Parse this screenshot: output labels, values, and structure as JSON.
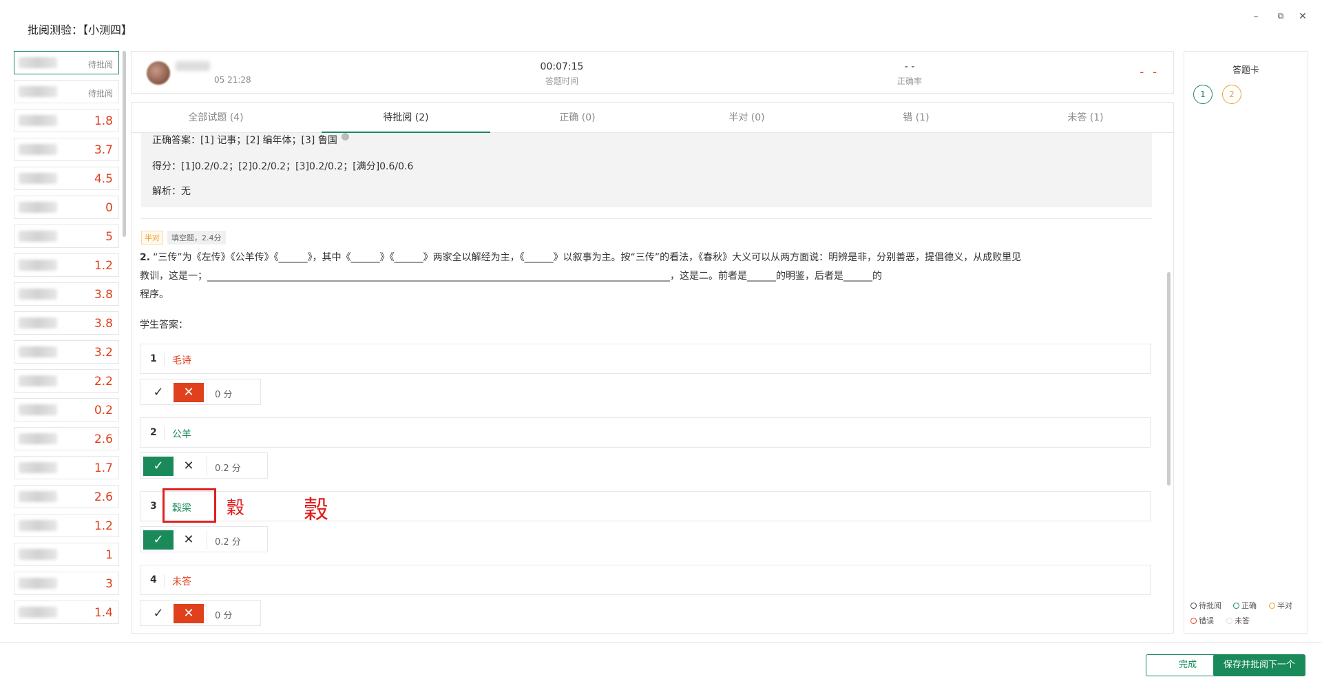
{
  "window": {
    "title": "批阅测验：【小测四】",
    "minimize": "–",
    "restore": "⧉",
    "close": "✕"
  },
  "students": [
    {
      "score": "待批阅",
      "pending": true,
      "active": true
    },
    {
      "score": "待批阅",
      "pending": true
    },
    {
      "score": "1.8"
    },
    {
      "score": "3.7"
    },
    {
      "score": "4.5"
    },
    {
      "score": "0"
    },
    {
      "score": "5"
    },
    {
      "score": "1.2"
    },
    {
      "score": "3.8"
    },
    {
      "score": "3.8"
    },
    {
      "score": "3.2"
    },
    {
      "score": "2.2"
    },
    {
      "score": "0.2"
    },
    {
      "score": "2.6"
    },
    {
      "score": "1.7"
    },
    {
      "score": "2.6"
    },
    {
      "score": "1.2"
    },
    {
      "score": "1"
    },
    {
      "score": "3"
    },
    {
      "score": "1.4"
    }
  ],
  "header": {
    "submit_time": "05 21:28",
    "duration_value": "00:07:15",
    "duration_label": "答题时间",
    "accuracy_value": "- -",
    "accuracy_label": "正确率",
    "score": "- -"
  },
  "tabs": [
    {
      "label": "全部试题 (4)"
    },
    {
      "label": "待批阅 (2)",
      "active": true
    },
    {
      "label": "正确 (0)"
    },
    {
      "label": "半对 (0)"
    },
    {
      "label": "错 (1)"
    },
    {
      "label": "未答 (1)"
    }
  ],
  "prev_question": {
    "correct_answer": "正确答案：[1] 记事；[2] 编年体；[3] 鲁国",
    "score_line": "得分：[1]0.2/0.2；[2]0.2/0.2；[3]0.2/0.2；[满分]0.6/0.6",
    "analysis": "解析：无"
  },
  "question": {
    "status_tag": "半对",
    "type_tag": "填空题，2.4分",
    "number": "2.",
    "line1": "“三传”为《左传》《公羊传》《______》，其中《______》《______》两家全以解经为主，《______》以叙事为主。按“三传”的看法，《春秋》大义可以从两方面说：明辨是非，分别善恶，提倡德义，从成败里见",
    "line2": "教训，这是一；________________________________________________________________________________________________，这是二。前者是______的明鉴，后者是______的",
    "line3": "程序。",
    "student_answer_label": "学生答案："
  },
  "answers": [
    {
      "num": "1",
      "text": "毛诗",
      "status": "wrong",
      "score": "0 分"
    },
    {
      "num": "2",
      "text": "公羊",
      "status": "right",
      "score": "0.2 分"
    },
    {
      "num": "3",
      "text": "穀梁",
      "status": "right",
      "score": "0.2 分"
    },
    {
      "num": "4",
      "text": "未答",
      "status": "wrong",
      "score": "0 分"
    }
  ],
  "annotations": {
    "char_small": "穀",
    "char_large": "穀"
  },
  "answer_card": {
    "title": "答题卡",
    "items": [
      {
        "num": "1",
        "state": "正确"
      },
      {
        "num": "2",
        "state": "半对"
      }
    ],
    "legend": [
      "待批阅",
      "正确",
      "半对",
      "错误",
      "未答"
    ]
  },
  "footer": {
    "done": "完成",
    "save_next": "保存并批阅下一个"
  },
  "colors": {
    "brand_green": "#1a8a5a",
    "error_red": "#e0401b",
    "half_orange": "#f0a030",
    "annotation_red": "#e02020"
  }
}
